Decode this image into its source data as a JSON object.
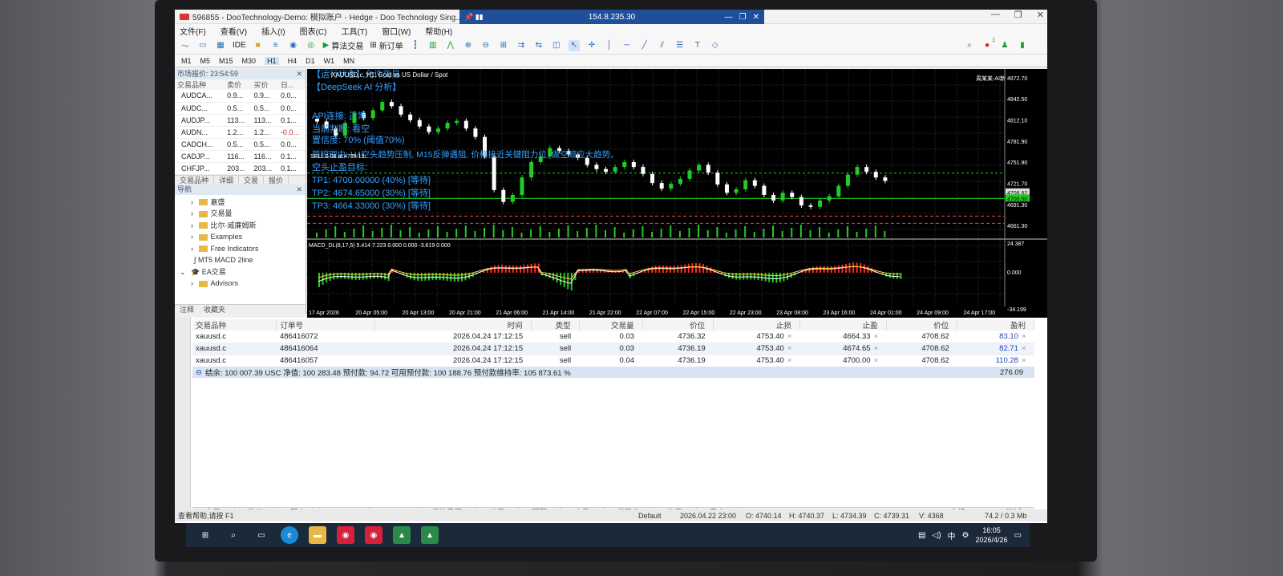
{
  "window": {
    "title": "596855 - DooTechnology-Demo: 模拟账户 - Hedge - Doo Technology Sing...",
    "rdp_host": "154.8.235.30"
  },
  "menu": [
    "文件(F)",
    "查看(V)",
    "插入(I)",
    "图表(C)",
    "工具(T)",
    "窗口(W)",
    "帮助(H)"
  ],
  "toolbar": {
    "ide": "IDE",
    "algo_trading": "算法交易",
    "new_order": "新订单",
    "notification_count": "1"
  },
  "timeframes": [
    "M1",
    "M5",
    "M15",
    "M30",
    "H1",
    "H4",
    "D1",
    "W1",
    "MN"
  ],
  "active_timeframe": "H1",
  "market_watch": {
    "header": "市场报价: 23:54:59",
    "columns": [
      "交易品种",
      "卖价",
      "买价",
      "日..."
    ],
    "rows": [
      {
        "symbol": "AUDCA...",
        "bid": "0.9...",
        "ask": "0.9...",
        "day": "0.0..."
      },
      {
        "symbol": "AUDC...",
        "bid": "0.5...",
        "ask": "0.5...",
        "day": "0.0..."
      },
      {
        "symbol": "AUDJP...",
        "bid": "113...",
        "ask": "113...",
        "day": "0.1..."
      },
      {
        "symbol": "AUDN...",
        "bid": "1.2...",
        "ask": "1.2...",
        "day": "-0.0..."
      },
      {
        "symbol": "CADCH...",
        "bid": "0.5...",
        "ask": "0.5...",
        "day": "0.0..."
      },
      {
        "symbol": "CADJP...",
        "bid": "116...",
        "ask": "116...",
        "day": "0.1..."
      },
      {
        "symbol": "CHFJP...",
        "bid": "203...",
        "ask": "203...",
        "day": "0.1..."
      }
    ],
    "tabs": [
      "交易品种",
      "详细",
      "交易",
      "报价"
    ]
  },
  "navigator": {
    "header": "导航",
    "items": [
      {
        "label": "嘉盛",
        "kind": "folder"
      },
      {
        "label": "交易量",
        "kind": "folder"
      },
      {
        "label": "比尔·威廉姆斯",
        "kind": "folder"
      },
      {
        "label": "Examples",
        "kind": "folder"
      },
      {
        "label": "Free Indicators",
        "kind": "folder"
      },
      {
        "label": "MT5 MACD 2line",
        "kind": "indicator"
      },
      {
        "label": "EA交易",
        "kind": "group"
      },
      {
        "label": "Advisors",
        "kind": "folder"
      }
    ],
    "tabs": [
      "注释",
      "收藏夹"
    ]
  },
  "chart": {
    "symbol_title": "XAUUSD.c, H1: Gold vs US Dollar / Spot",
    "ea_name": "周某某-AI新",
    "overlay_lines": [
      "【运行状态】允许交易",
      "【DeepSeek AI 分析】",
      "API连接: 正常",
      "当前判断: 看空",
      "置信度: 70% (阈值70%)",
      "简短理由: H4空头趋势压制, M15反弹遇阻, 价格接近关键阻力位, 做空顺应大趋势。",
      "空头止盈目标:",
      "TP1: 4700.00000 (40%) [等待]",
      "TP2: 4674.65000 (30%) [等待]",
      "TP3: 4664.33000 (30%) [等待]"
    ],
    "sell_label": "SELL 0.04 at 4736.19",
    "price_labels": [
      "4872.70",
      "4842.50",
      "4812.10",
      "4781.90",
      "4751.90",
      "4721.70",
      "4708.62",
      "4700.00",
      "4691.30",
      "4661.30"
    ],
    "current_price": "4708.62",
    "indicator_label": "MACD_DL(8,17,5) 5.414 7.223 0.000 0.000 -3.619 0.000",
    "indicator_scale": [
      "24.387",
      "0.000",
      "-34.199"
    ],
    "time_labels": [
      "17 Apr 2026",
      "20 Apr 05:00",
      "20 Apr 13:00",
      "20 Apr 21:00",
      "21 Apr 06:00",
      "21 Apr 14:00",
      "21 Apr 22:00",
      "22 Apr 07:00",
      "22 Apr 15:00",
      "22 Apr 23:00",
      "23 Apr 08:00",
      "23 Apr 16:00",
      "24 Apr 01:00",
      "24 Apr 09:00",
      "24 Apr 17:00"
    ],
    "colors": {
      "bg": "#000000",
      "grid": "#2a3a4a",
      "bull": "#22cc22",
      "bear": "#ffffff",
      "text": "#33a0ff",
      "tp": "#ff4040",
      "macd_up": "#22cc22",
      "macd_down": "#ff2a2a",
      "signal": "#ffd030"
    }
  },
  "chart_data": {
    "type": "candlestick",
    "title": "XAUUSD.c, H1: Gold vs US Dollar / Spot",
    "ylim": [
      4651,
      4876
    ],
    "tp_lines": [
      4700.0,
      4674.65,
      4664.33
    ],
    "entry": 4736.19,
    "close_path": [
      4810,
      4800,
      4790,
      4808,
      4822,
      4815,
      4826,
      4838,
      4832,
      4820,
      4812,
      4803,
      4795,
      4800,
      4808,
      4811,
      4800,
      4788,
      4760,
      4712,
      4695,
      4705,
      4730,
      4752,
      4760,
      4772,
      4768,
      4763,
      4758,
      4748,
      4742,
      4738,
      4745,
      4752,
      4745,
      4735,
      4722,
      4714,
      4721,
      4728,
      4740,
      4748,
      4737,
      4720,
      4708,
      4713,
      4726,
      4718,
      4705,
      4697,
      4708,
      4702,
      4690,
      4688,
      4697,
      4703,
      4718,
      4734,
      4745,
      4738,
      4730,
      4725
    ]
  },
  "positions": {
    "columns": [
      "交易品种",
      "订单号",
      "时间",
      "类型",
      "交易量",
      "价位",
      "止损",
      "止盈",
      "价位",
      "盈利"
    ],
    "rows": [
      {
        "symbol": "xauusd.c",
        "ticket": "486416072",
        "time": "2026.04.24 17:12:15",
        "type": "sell",
        "volume": "0.03",
        "open": "4736.32",
        "sl": "4753.40",
        "tp": "4664.33",
        "price": "4708.62",
        "profit": "83.10"
      },
      {
        "symbol": "xauusd.c",
        "ticket": "486416064",
        "time": "2026.04.24 17:12:15",
        "type": "sell",
        "volume": "0.03",
        "open": "4736.19",
        "sl": "4753.40",
        "tp": "4674.65",
        "price": "4708.62",
        "profit": "82.71"
      },
      {
        "symbol": "xauusd.c",
        "ticket": "486416057",
        "time": "2026.04.24 17:12:15",
        "type": "sell",
        "volume": "0.04",
        "open": "4736.19",
        "sl": "4753.40",
        "tp": "4700.00",
        "price": "4708.62",
        "profit": "110.28"
      }
    ],
    "summary": "结余: 100 007.39 USC  净值: 100 283.48  预付款: 94.72  可用预付款: 100 188.76  预付款维持率: 105 873.61 %",
    "total_profit": "276.09"
  },
  "terminal_tabs": [
    {
      "label": "交易",
      "badge": ""
    },
    {
      "label": "敞口",
      "badge": ""
    },
    {
      "label": "历史",
      "badge": ""
    },
    {
      "label": "新闻",
      "badge": "99"
    },
    {
      "label": "邮箱",
      "badge": "11"
    },
    {
      "label": "经济日历",
      "badge": ""
    },
    {
      "label": "公司",
      "badge": ""
    },
    {
      "label": "预警",
      "badge": ""
    },
    {
      "label": "文章",
      "badge": ""
    },
    {
      "label": "代码库",
      "badge": ""
    },
    {
      "label": "专家",
      "badge": ""
    },
    {
      "label": "日志",
      "badge": ""
    }
  ],
  "terminal_right": [
    "市场",
    "VPS",
    "测试"
  ],
  "status": {
    "help": "查看帮助,请按 F1",
    "profile": "Default",
    "datetime": "2026.04.22 23:00",
    "open": "O: 4740.14",
    "high": "H: 4740.37",
    "low": "L: 4734.39",
    "close": "C: 4739.31",
    "volume": "V: 4368",
    "traffic": "74.2 / 0.3 Mb"
  },
  "taskbar": {
    "time": "16:05",
    "date": "2026/4/26",
    "ime": "中"
  }
}
